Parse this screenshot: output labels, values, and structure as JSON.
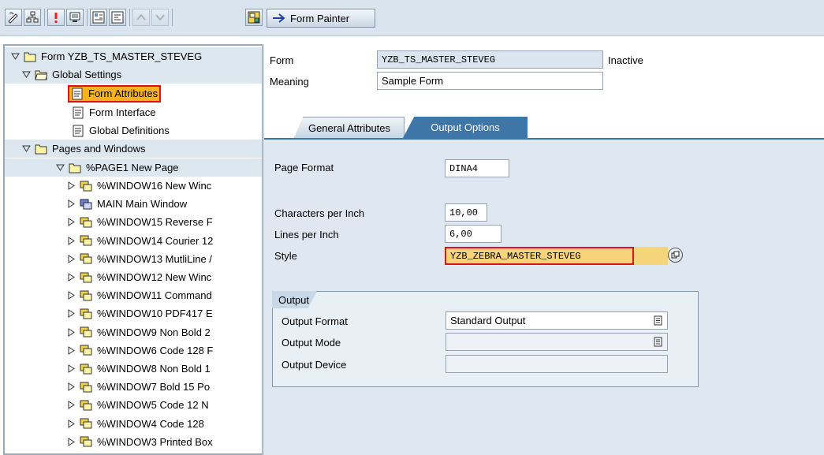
{
  "toolbar": {
    "buttons": [
      {
        "name": "pen-icon"
      },
      {
        "name": "hierarchy-icon"
      },
      {
        "name": "exclamation-icon"
      },
      {
        "name": "display-icon"
      },
      {
        "name": "expand-icon"
      },
      {
        "name": "collapse-icon"
      },
      {
        "name": "move-up-icon",
        "disabled": true
      },
      {
        "name": "move-down-icon",
        "disabled": true
      },
      {
        "name": "layout-icon"
      }
    ],
    "form_painter_label": "Form Painter"
  },
  "tree": {
    "root_label": "Form YZB_TS_MASTER_STEVEG",
    "global_settings_label": "Global Settings",
    "form_attributes_label": "Form Attributes",
    "form_interface_label": "Form Interface",
    "global_definitions_label": "Global Definitions",
    "pages_windows_label": "Pages and Windows",
    "page1_label": "%PAGE1 New Page",
    "windows": [
      "%WINDOW16 New Winc",
      "MAIN Main Window",
      "%WINDOW15 Reverse F",
      "%WINDOW14 Courier 12",
      "%WINDOW13 MutliLine /",
      "%WINDOW12 New Winc",
      "%WINDOW11 Command",
      "%WINDOW10 PDF417 E",
      "%WINDOW9 Non Bold 2",
      "%WINDOW6 Code 128 F",
      "%WINDOW8 Non Bold 1",
      "%WINDOW7 Bold 15 Po",
      "%WINDOW5 Code 12 N",
      "%WINDOW4 Code 128",
      "%WINDOW3 Printed Box"
    ]
  },
  "header": {
    "form_label": "Form",
    "form_value": "YZB_TS_MASTER_STEVEG",
    "status": "Inactive",
    "meaning_label": "Meaning",
    "meaning_value": "Sample Form"
  },
  "tabs": {
    "general": "General Attributes",
    "output": "Output Options"
  },
  "output_options": {
    "page_format_label": "Page Format",
    "page_format_value": "DINA4",
    "cpi_label": "Characters per Inch",
    "cpi_value": "10,00",
    "lpi_label": "Lines per Inch",
    "lpi_value": "6,00",
    "style_label": "Style",
    "style_value": "YZB_ZEBRA_MASTER_STEVEG",
    "group_title": "Output",
    "output_format_label": "Output Format",
    "output_format_value": "Standard Output",
    "output_mode_label": "Output Mode",
    "output_mode_value": "",
    "output_device_label": "Output Device",
    "output_device_value": ""
  },
  "colors": {
    "highlight": "#f7b21d",
    "highlight_border": "#e0101a",
    "active_tab": "#3f76a8",
    "panel": "#dfe8f1"
  }
}
